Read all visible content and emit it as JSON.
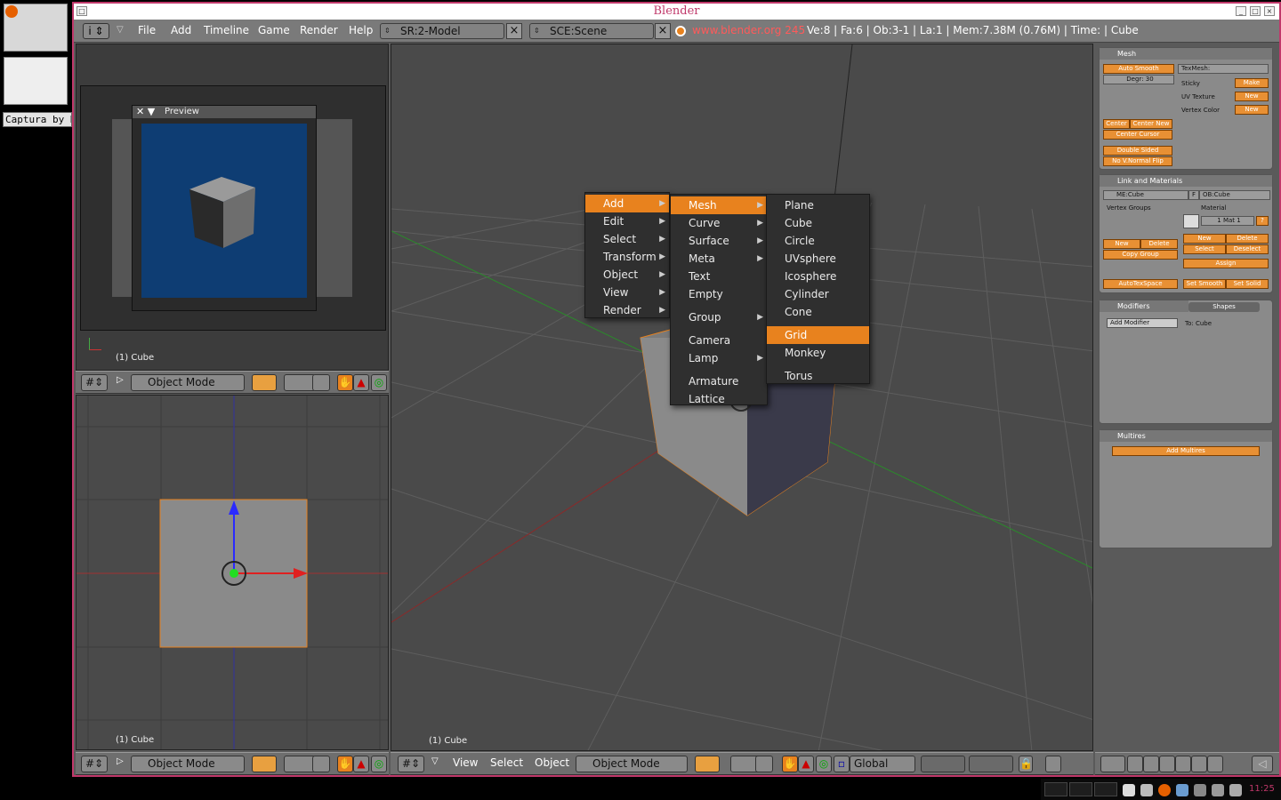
{
  "desktop": {
    "taskbar_label": "Captura by He",
    "clock": "11:25"
  },
  "window": {
    "title": "Blender",
    "menubar": {
      "menus": [
        "File",
        "Add",
        "Timeline",
        "Game",
        "Render",
        "Help"
      ],
      "screen_field": "SR:2-Model",
      "scene_field": "SCE:Scene",
      "link_text": "www.blender.org 245",
      "stats": "Ve:8 | Fa:6 | Ob:3-1 | La:1  | Mem:7.38M (0.76M)  | Time: | Cube"
    }
  },
  "views": {
    "camera_label": "(1) Cube",
    "top_label": "(1) Cube",
    "main_label": "(1) Cube",
    "preview_title": "Preview",
    "mode": "Object Mode",
    "main_header": {
      "menus": [
        "View",
        "Select",
        "Object"
      ],
      "mode": "Object Mode",
      "orientation": "Global"
    }
  },
  "add_menu": {
    "level1": [
      "Add",
      "Edit",
      "Select",
      "Transform",
      "Object",
      "View",
      "Render"
    ],
    "level2": [
      "Mesh",
      "Curve",
      "Surface",
      "Meta",
      "Text",
      "Empty",
      "Group",
      "Camera",
      "Lamp",
      "Armature",
      "Lattice"
    ],
    "level3": [
      "Plane",
      "Cube",
      "Circle",
      "UVsphere",
      "Icosphere",
      "Cylinder",
      "Cone",
      "Grid",
      "Monkey",
      "Torus"
    ],
    "highlight1": "Add",
    "highlight2": "Mesh",
    "highlight3": "Grid"
  },
  "buttons_panel": {
    "mesh": {
      "title": "Mesh",
      "auto_smooth": "Auto Smooth",
      "degr": "Degr: 30",
      "texmesh": "TexMesh:",
      "sticky": "Sticky",
      "uv_texture": "UV Texture",
      "vertex_color": "Vertex Color",
      "make": "Make",
      "new1": "New",
      "new2": "New",
      "center": "Center",
      "center_new": "Center New",
      "center_cursor": "Center Cursor",
      "double_sided": "Double Sided",
      "no_vnormal_flip": "No V.Normal Flip"
    },
    "link": {
      "title": "Link and Materials",
      "me": "ME:Cube",
      "f": "F",
      "ob": "OB:Cube",
      "vertex_groups": "Vertex Groups",
      "material": "Material",
      "mat_slot": "1 Mat 1",
      "question": "?",
      "new_l": "New",
      "delete_l": "Delete",
      "copy_group": "Copy Group",
      "new_r": "New",
      "delete_r": "Delete",
      "select": "Select",
      "deselect": "Deselect",
      "assign": "Assign",
      "autotexspace": "AutoTexSpace",
      "set_smooth": "Set Smooth",
      "set_solid": "Set Solid"
    },
    "modifiers": {
      "tab1": "Modifiers",
      "tab2": "Shapes",
      "add_modifier": "Add Modifier",
      "to": "To: Cube"
    },
    "multires": {
      "title": "Multires",
      "add": "Add Multires"
    }
  },
  "colors": {
    "accent_orange": "#e8821e",
    "window_border": "#c0386a",
    "viewport_bg": "#4a4a4a"
  }
}
